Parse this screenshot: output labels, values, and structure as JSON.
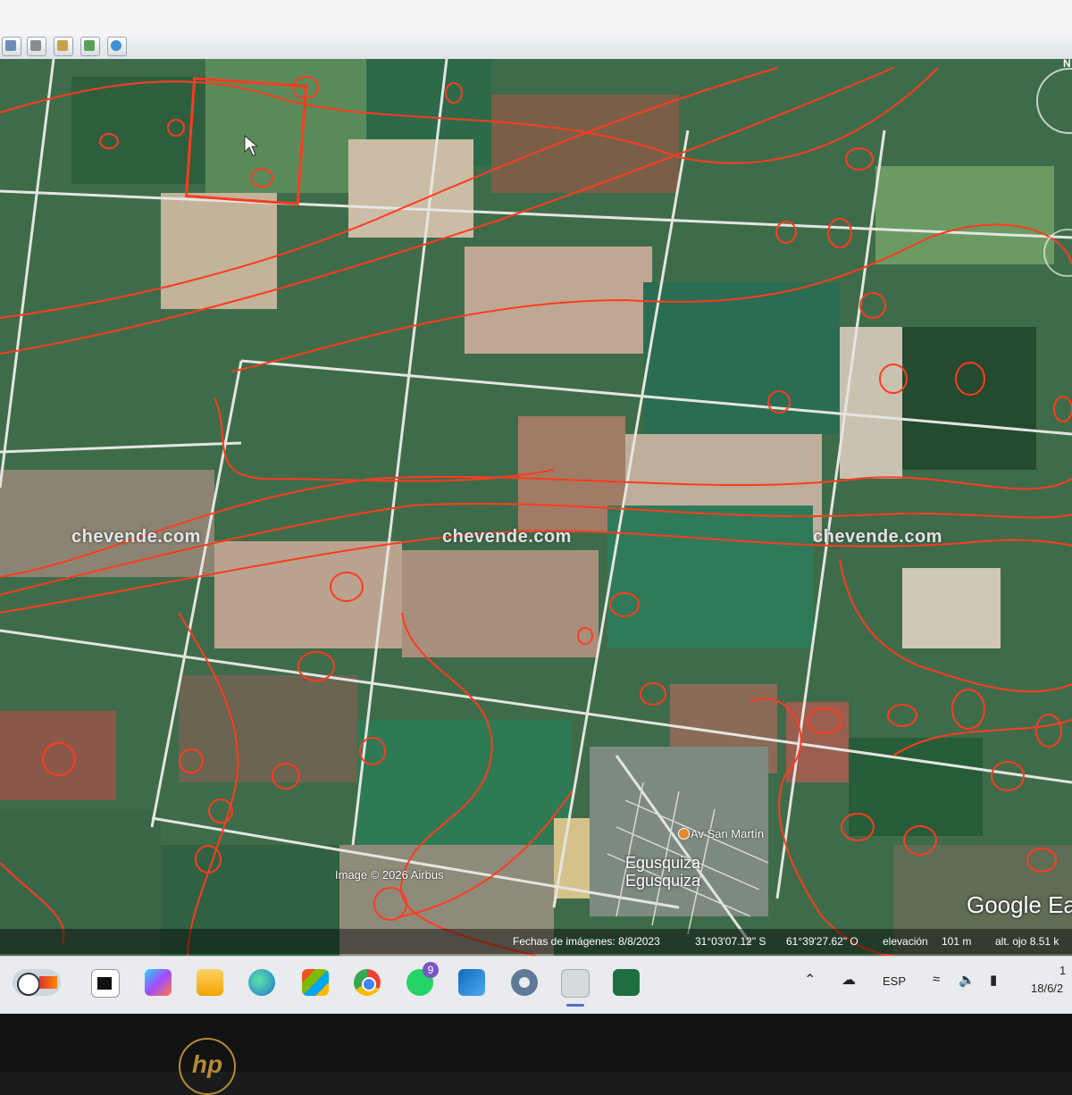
{
  "map": {
    "watermarks": [
      "chevende.com",
      "chevende.com",
      "chevende.com"
    ],
    "copyright": "Image © 2026 Airbus",
    "road_label": "Av San Martín",
    "place_label_1": "Egusquiza",
    "place_label_2": "Egusquiza",
    "google_logo": "Google Ea",
    "north_label": "N"
  },
  "status_bar": {
    "imagery_date": "Fechas de imágenes: 8/8/2023",
    "lat": "31°03'07.12\" S",
    "lon": "61°39'27.62\" O",
    "elevation_label": "elevación",
    "elevation_value": "101 m",
    "eye_alt": "alt. ojo  8.51 k"
  },
  "taskbar": {
    "whatsapp_badge": "9",
    "language": "ESP",
    "time": "1",
    "date": "18/6/2"
  },
  "colors": {
    "contour": "#ff3b1f",
    "taskbar": "#e9ebee",
    "field_green": "#2f6a49",
    "field_tan": "#b9a48a",
    "road": "#e5e5e0"
  }
}
